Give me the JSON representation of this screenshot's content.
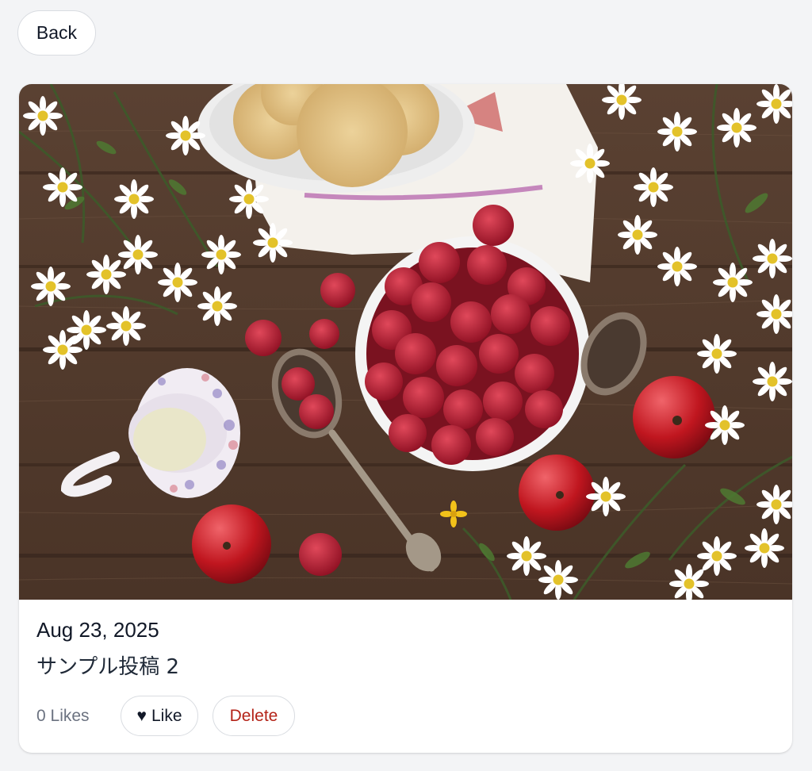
{
  "nav": {
    "back_label": "Back"
  },
  "post": {
    "date": "Aug 23, 2025",
    "title": "サンプル投稿 2",
    "likes_text": "0 Likes",
    "like_icon": "heart-icon",
    "like_glyph": "♥",
    "like_label": "Like",
    "delete_label": "Delete"
  },
  "colors": {
    "page_background": "#f3f4f6",
    "card_background": "#ffffff",
    "button_border": "#d9dce1",
    "delete_text": "#b42318",
    "muted_text": "#6b7280"
  }
}
